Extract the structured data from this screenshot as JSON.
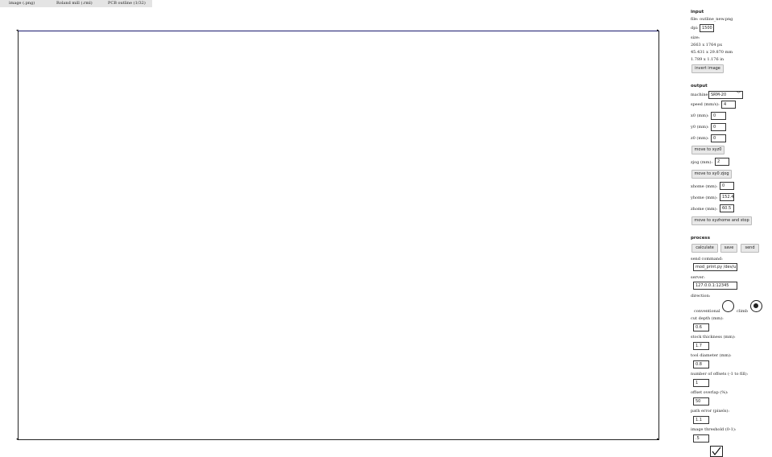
{
  "topbar": {
    "tab_image": "image (.png)",
    "tab_machine": "Roland mill (.rml)",
    "tab_process": "PCB outline (1/32)"
  },
  "input": {
    "heading": "input",
    "file_label": "file: outline_new.png",
    "dpi_label": "dpi:",
    "dpi_value": "1500",
    "size_label": "size:",
    "size_px": "2663 x 1764 px",
    "size_mm": "45.431 x 29.870 mm",
    "size_in": "1.789 x 1.176 in",
    "invert_label": "invert image"
  },
  "output": {
    "heading": "output",
    "machine_label": "machine",
    "machine_value": "SRM-20",
    "speed_label": "speed (mm/s):",
    "speed_value": "4",
    "x0_label": "x0 (mm):",
    "x0_value": "0",
    "y0_label": "y0 (mm):",
    "y0_value": "0",
    "z0_label": "z0 (mm):",
    "z0_value": "0",
    "move_xyz0_label": "move to xyz0",
    "zjog_label": "zjog (mm):",
    "zjog_value": "2",
    "move_xy0_label": "move to xy0 zjog",
    "xhome_label": "xhome (mm):",
    "xhome_value": "0",
    "yhome_label": "yhome (mm):",
    "yhome_value": "152.4",
    "zhome_label": "zhome (mm):",
    "zhome_value": "60.5",
    "move_home_label": "move to xyzhome and stop"
  },
  "process": {
    "heading": "process",
    "calculate_label": "calculate",
    "save_label": "save",
    "send_label": "send",
    "send_command_label": "send command:",
    "send_command_value": "mod_print.py /dev/u",
    "server_label": "server:",
    "server_value": "127.0.0.1:12345",
    "direction_label": "direction:",
    "conventional_label": "conventional",
    "climb_label": "climb",
    "cut_depth_label": "cut depth (mm):",
    "cut_depth_value": "0.6",
    "stock_label": "stock thickness (mm):",
    "stock_value": "1.7",
    "tool_label": "tool diameter (mm):",
    "tool_value": "0.8",
    "offsets_label": "number of offsets (-1 to fill):",
    "offsets_value": "1",
    "overlap_label": "offset overlap (%):",
    "overlap_value": "50",
    "path_error_label": "path error (pixels):",
    "path_error_value": "1.1",
    "threshold_label": "image threshold (0-1):",
    "threshold_value": ".5"
  }
}
